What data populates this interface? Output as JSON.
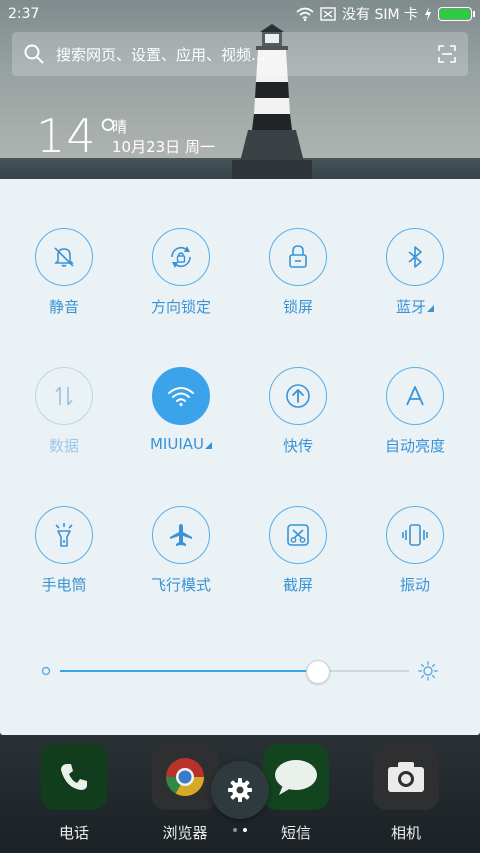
{
  "status_bar": {
    "time": "2:37",
    "carrier": "没有 SIM 卡",
    "battery_level": 1.0
  },
  "search": {
    "placeholder": "搜索网页、设置、应用、视频..."
  },
  "weather": {
    "temperature": "14°",
    "condition": "晴",
    "date": "10月23日 周一"
  },
  "quick_settings": {
    "tiles": [
      {
        "label": "静音",
        "icon": "bell-off-icon",
        "state": "off"
      },
      {
        "label": "方向锁定",
        "icon": "rotation-lock-icon",
        "state": "off"
      },
      {
        "label": "锁屏",
        "icon": "lock-icon",
        "state": "off"
      },
      {
        "label": "蓝牙",
        "icon": "bluetooth-icon",
        "state": "off"
      },
      {
        "label": "数据",
        "icon": "data-arrows-icon",
        "state": "disabled"
      },
      {
        "label": "MIUIAU",
        "icon": "wifi-icon",
        "state": "on"
      },
      {
        "label": "快传",
        "icon": "upload-icon",
        "state": "off"
      },
      {
        "label": "自动亮度",
        "icon": "auto-brightness-icon",
        "state": "off"
      },
      {
        "label": "手电筒",
        "icon": "flashlight-icon",
        "state": "off"
      },
      {
        "label": "飞行模式",
        "icon": "airplane-icon",
        "state": "off"
      },
      {
        "label": "截屏",
        "icon": "screenshot-icon",
        "state": "off"
      },
      {
        "label": "振动",
        "icon": "vibrate-icon",
        "state": "off"
      }
    ],
    "brightness": 0.74
  },
  "dock": {
    "apps": [
      {
        "label": "电话",
        "icon": "phone-icon"
      },
      {
        "label": "浏览器",
        "icon": "browser-icon"
      },
      {
        "label": "短信",
        "icon": "message-icon"
      },
      {
        "label": "相机",
        "icon": "camera-icon"
      }
    ]
  },
  "colors": {
    "accent": "#3aa3ea",
    "panel_bg": "#eaf2f5",
    "battery": "#2ecc40"
  }
}
